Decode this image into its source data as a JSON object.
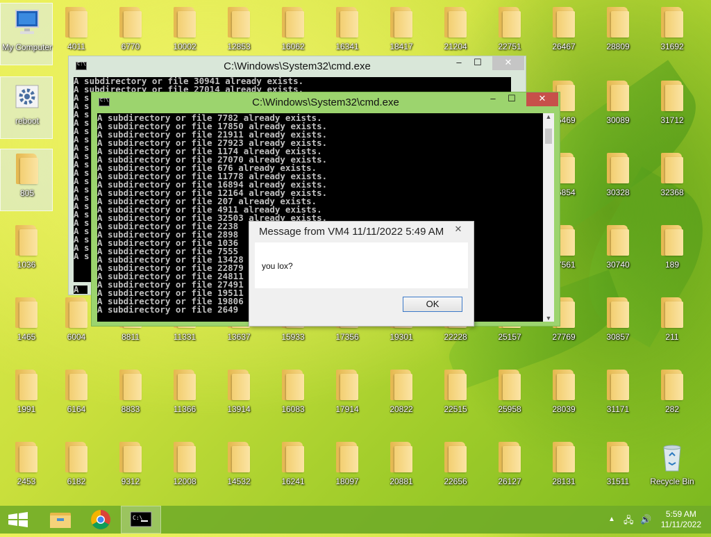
{
  "desktop": {
    "icons": [
      {
        "label": "My Computer",
        "type": "computer"
      },
      {
        "label": "reboot",
        "type": "gear"
      },
      {
        "label": "805",
        "type": "folder"
      },
      {
        "label": "1036",
        "type": "folder"
      },
      {
        "label": "1465",
        "type": "folder"
      },
      {
        "label": "1991",
        "type": "folder"
      },
      {
        "label": "2453",
        "type": "folder"
      },
      {
        "label": "4011",
        "type": "folder"
      },
      {
        "label": "6004",
        "type": "folder"
      },
      {
        "label": "6164",
        "type": "folder"
      },
      {
        "label": "6182",
        "type": "folder"
      },
      {
        "label": "6770",
        "type": "folder"
      },
      {
        "label": "8811",
        "type": "folder"
      },
      {
        "label": "8833",
        "type": "folder"
      },
      {
        "label": "9312",
        "type": "folder"
      },
      {
        "label": "10002",
        "type": "folder"
      },
      {
        "label": "11331",
        "type": "folder"
      },
      {
        "label": "11366",
        "type": "folder"
      },
      {
        "label": "12008",
        "type": "folder"
      },
      {
        "label": "12853",
        "type": "folder"
      },
      {
        "label": "13637",
        "type": "folder"
      },
      {
        "label": "13914",
        "type": "folder"
      },
      {
        "label": "14532",
        "type": "folder"
      },
      {
        "label": "16062",
        "type": "folder"
      },
      {
        "label": "15933",
        "type": "folder"
      },
      {
        "label": "16083",
        "type": "folder"
      },
      {
        "label": "16241",
        "type": "folder"
      },
      {
        "label": "16341",
        "type": "folder"
      },
      {
        "label": "17356",
        "type": "folder"
      },
      {
        "label": "17914",
        "type": "folder"
      },
      {
        "label": "18097",
        "type": "folder"
      },
      {
        "label": "18417",
        "type": "folder"
      },
      {
        "label": "19301",
        "type": "folder"
      },
      {
        "label": "20822",
        "type": "folder"
      },
      {
        "label": "20881",
        "type": "folder"
      },
      {
        "label": "21204",
        "type": "folder"
      },
      {
        "label": "22228",
        "type": "folder"
      },
      {
        "label": "22515",
        "type": "folder"
      },
      {
        "label": "22656",
        "type": "folder"
      },
      {
        "label": "22751",
        "type": "folder"
      },
      {
        "label": "25157",
        "type": "folder"
      },
      {
        "label": "25958",
        "type": "folder"
      },
      {
        "label": "26127",
        "type": "folder"
      },
      {
        "label": "26467",
        "type": "folder"
      },
      {
        "label": "26469",
        "type": "folder"
      },
      {
        "label": "26854",
        "type": "folder"
      },
      {
        "label": "27561",
        "type": "folder"
      },
      {
        "label": "27769",
        "type": "folder"
      },
      {
        "label": "28039",
        "type": "folder"
      },
      {
        "label": "28131",
        "type": "folder"
      },
      {
        "label": "28809",
        "type": "folder"
      },
      {
        "label": "30089",
        "type": "folder"
      },
      {
        "label": "30328",
        "type": "folder"
      },
      {
        "label": "30740",
        "type": "folder"
      },
      {
        "label": "30857",
        "type": "folder"
      },
      {
        "label": "31171",
        "type": "folder"
      },
      {
        "label": "31511",
        "type": "folder"
      },
      {
        "label": "31692",
        "type": "folder"
      },
      {
        "label": "31712",
        "type": "folder"
      },
      {
        "label": "32368",
        "type": "folder"
      },
      {
        "label": "189",
        "type": "folder"
      },
      {
        "label": "211",
        "type": "folder"
      },
      {
        "label": "282",
        "type": "folder"
      },
      {
        "label": "Recycle Bin",
        "type": "recycle"
      }
    ]
  },
  "cmd_back": {
    "title": "C:\\Windows\\System32\\cmd.exe",
    "lines": [
      "A subdirectory or file 30941 already exists.",
      "A subdirectory or file 27014 already exists.",
      "A s",
      "A s",
      "A s",
      "A s",
      "A s",
      "A s",
      "A s",
      "A s",
      "A s",
      "A s",
      "A s",
      "A s",
      "A s",
      "A s",
      "A s",
      "A s",
      "A s",
      "A s",
      "A s",
      "A s"
    ],
    "prompt": "A"
  },
  "cmd_front": {
    "title": "C:\\Windows\\System32\\cmd.exe",
    "lines": [
      "A subdirectory or file 7782 already exists.",
      "A subdirectory or file 17850 already exists.",
      "A subdirectory or file 21911 already exists.",
      "A subdirectory or file 27923 already exists.",
      "A subdirectory or file 1174 already exists.",
      "A subdirectory or file 27070 already exists.",
      "A subdirectory or file 676 already exists.",
      "A subdirectory or file 11778 already exists.",
      "A subdirectory or file 16894 already exists.",
      "A subdirectory or file 12164 already exists.",
      "A subdirectory or file 207 already exists.",
      "A subdirectory or file 4911 already exists.",
      "A subdirectory or file 32503 already exists.",
      "A subdirectory or file 2238",
      "A subdirectory or file 2898",
      "A subdirectory or file 1036",
      "A subdirectory or file 7555",
      "A subdirectory or file 13428",
      "A subdirectory or file 22879",
      "A subdirectory or file 24811",
      "A subdirectory or file 27491",
      "A subdirectory or file 19511",
      "A subdirectory or file 19806",
      "A subdirectory or file 2649"
    ]
  },
  "message": {
    "title": "Message from VM4 11/11/2022 5:49 AM",
    "text": "you lox?",
    "ok_label": "OK"
  },
  "taskbar": {
    "time": "5:59 AM",
    "date": "11/11/2022"
  },
  "colors": {
    "close_red": "#c7504a",
    "cmd_frame": "#9cd46e",
    "taskbar": "#6eaa28"
  }
}
